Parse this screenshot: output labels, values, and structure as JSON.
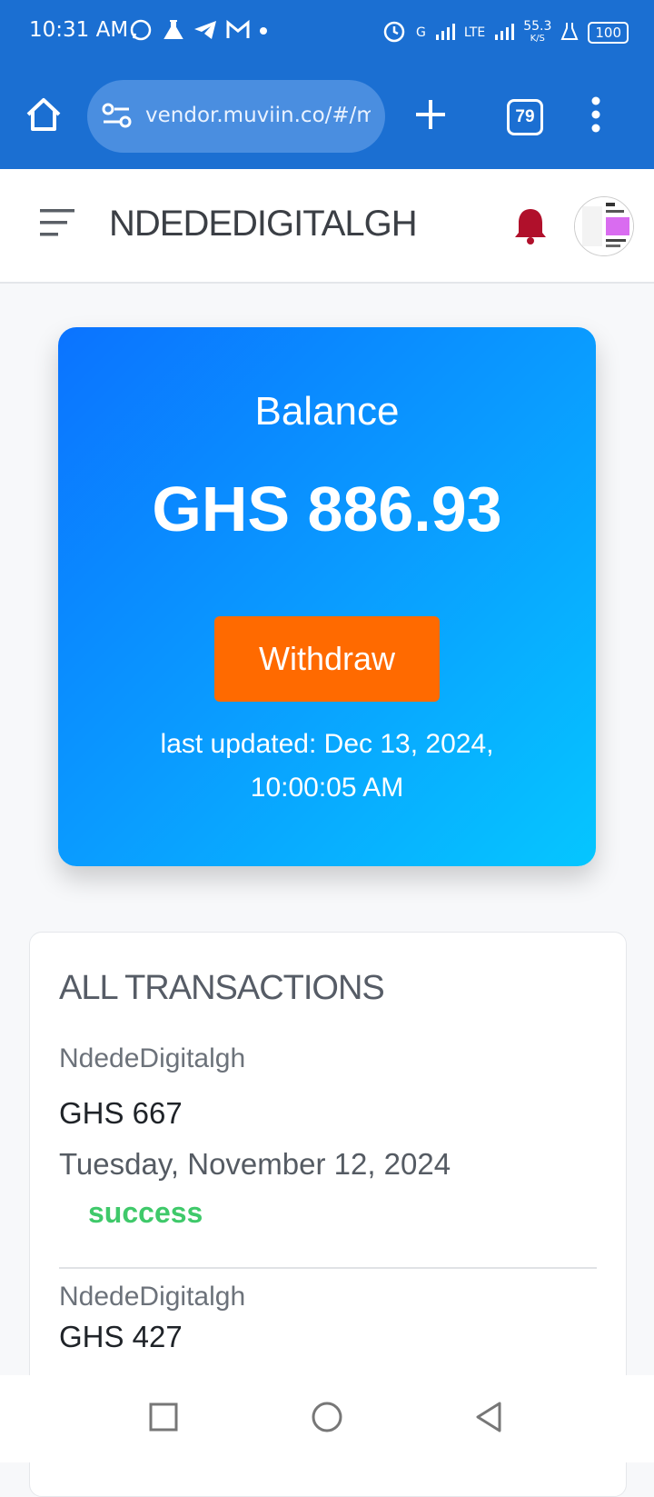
{
  "status_bar": {
    "time": "10:31 AM",
    "net_speed": "55.3",
    "net_unit": "K/S",
    "battery": "100",
    "signal_g": "G",
    "signal_lte": "LTE"
  },
  "browser": {
    "url": "vendor.muviin.co/#/ma",
    "tab_count": "79"
  },
  "header": {
    "brand": "NDEDEDIGITALGH"
  },
  "balance": {
    "label": "Balance",
    "amount": "GHS 886.93",
    "withdraw_label": "Withdraw",
    "updated_line1": "last updated: Dec 13, 2024,",
    "updated_line2": "10:00:05 AM"
  },
  "transactions": {
    "title": "ALL TRANSACTIONS",
    "items": [
      {
        "name": "NdedeDigitalgh",
        "amount": "GHS 667",
        "date": "Tuesday, November 12, 2024",
        "status": "success"
      },
      {
        "name": "NdedeDigitalgh",
        "amount": "GHS 427"
      }
    ]
  },
  "colors": {
    "chrome": "#1b6fd2",
    "accent_orange": "#ff6a00",
    "success_green": "#3fc96a",
    "bell_red": "#b0102b"
  }
}
